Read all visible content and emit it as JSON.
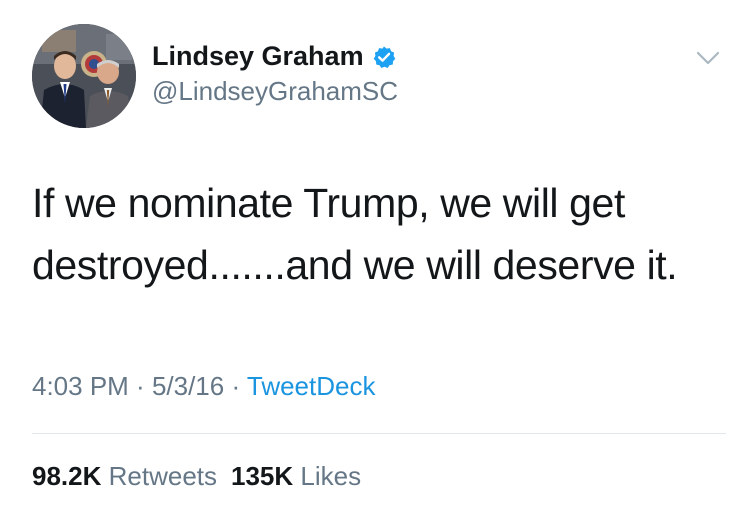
{
  "tweet": {
    "author": {
      "display_name": "Lindsey Graham",
      "handle": "@LindseyGrahamSC",
      "verified": true,
      "verified_color": "#1DA1F2",
      "avatar_icon": "profile-photo"
    },
    "menu_icon": "chevron-down-icon",
    "text_line1": "If we nominate Trump, we will get",
    "text_line2": "destroyed.......and we will deserve it.",
    "meta": {
      "time": "4:03 PM",
      "separator1": " · ",
      "date": "5/3/16",
      "separator2": " · ",
      "source": "TweetDeck"
    },
    "stats": {
      "retweets_count": "98.2K",
      "retweets_label": "Retweets",
      "likes_count": "135K",
      "likes_label": "Likes"
    }
  },
  "colors": {
    "text": "#14171a",
    "secondary": "#657786",
    "link": "#1b95e0",
    "divider": "#e1e8ed"
  }
}
